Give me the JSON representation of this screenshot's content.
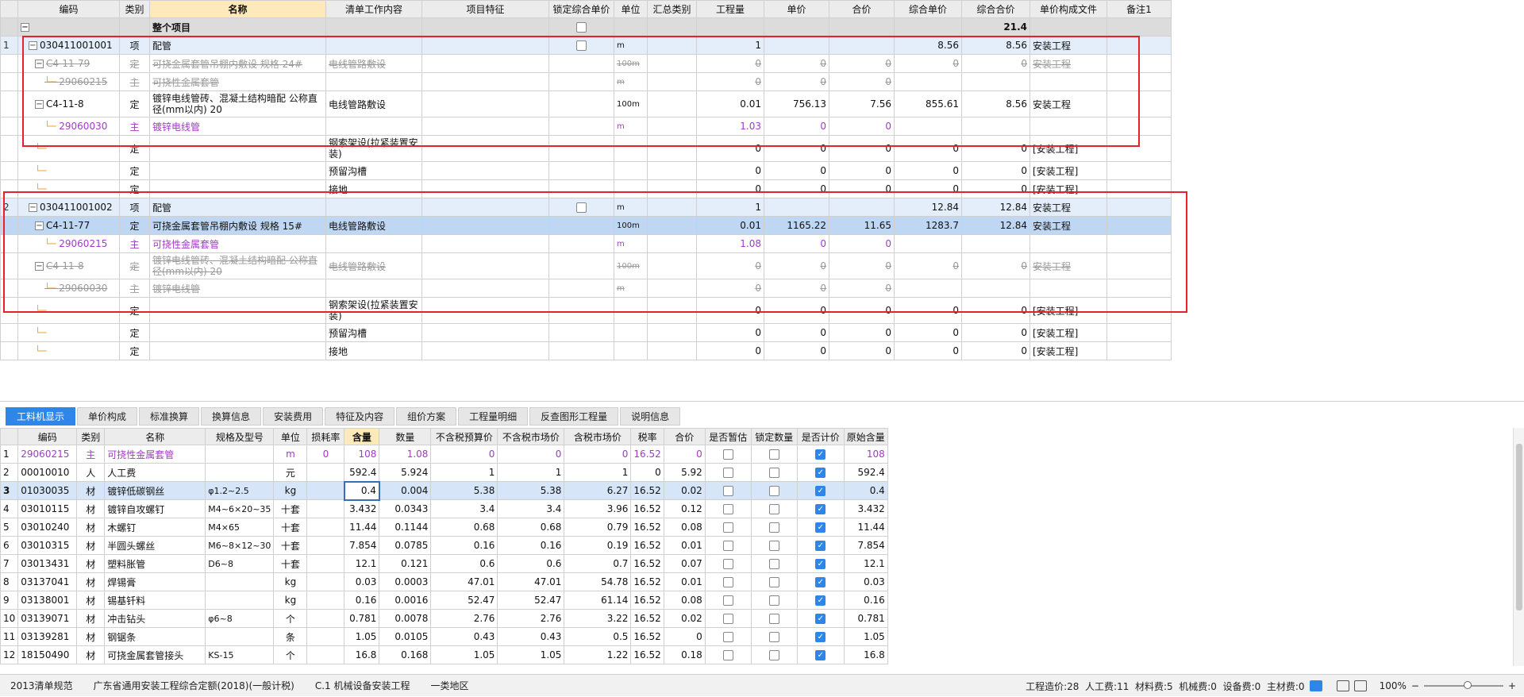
{
  "top_table": {
    "headers": [
      "编码",
      "类别",
      "名称",
      "清单工作内容",
      "项目特征",
      "锁定综合单价",
      "单位",
      "汇总类别",
      "工程量",
      "单价",
      "合价",
      "综合单价",
      "综合合价",
      "单价构成文件",
      "备注1"
    ],
    "rows": [
      {
        "no": "",
        "code": "",
        "type": "",
        "name": "整个项目",
        "work": "",
        "unit": "",
        "qty": "",
        "price": "",
        "total": "",
        "cprice": "",
        "ctotal": "21.4",
        "file": "",
        "kind": "whole"
      },
      {
        "no": "1",
        "code": "030411001001",
        "type": "项",
        "name": "配管",
        "work": "",
        "unit": "m",
        "qty": "1",
        "price": "",
        "total": "",
        "cprice": "8.56",
        "ctotal": "8.56",
        "file": "安装工程",
        "kind": "grp"
      },
      {
        "no": "",
        "code": "C4-11-79",
        "type": "定",
        "name": "可挠金属套管吊棚内敷设 规格 24#",
        "work": "电线管路敷设",
        "unit": "100m",
        "qty": "0",
        "price": "0",
        "total": "0",
        "cprice": "0",
        "ctotal": "0",
        "file": "安装工程",
        "kind": "strike"
      },
      {
        "no": "",
        "code": "29060215",
        "type": "主",
        "name": "可挠性金属套管",
        "work": "",
        "unit": "m",
        "qty": "0",
        "price": "0",
        "total": "0",
        "cprice": "",
        "ctotal": "",
        "file": "",
        "kind": "strike"
      },
      {
        "no": "",
        "code": "C4-11-8",
        "type": "定",
        "name": "镀锌电线管砖、混凝土结构暗配 公称直径(mm以内) 20",
        "work": "电线管路敷设",
        "unit": "100m",
        "qty": "0.01",
        "price": "756.13",
        "total": "7.56",
        "cprice": "855.61",
        "ctotal": "8.56",
        "file": "安装工程",
        "kind": "tall"
      },
      {
        "no": "",
        "code": "29060030",
        "type": "主",
        "name": "镀锌电线管",
        "work": "",
        "unit": "m",
        "qty": "1.03",
        "price": "0",
        "total": "0",
        "cprice": "",
        "ctotal": "",
        "file": "",
        "kind": "purple"
      },
      {
        "no": "",
        "code": "",
        "type": "定",
        "name": "",
        "work": "钢索架设(拉紧装置安装)",
        "unit": "",
        "qty": "0",
        "price": "0",
        "total": "0",
        "cprice": "0",
        "ctotal": "0",
        "file": "[安装工程]",
        "kind": "sub"
      },
      {
        "no": "",
        "code": "",
        "type": "定",
        "name": "",
        "work": "预留沟槽",
        "unit": "",
        "qty": "0",
        "price": "0",
        "total": "0",
        "cprice": "0",
        "ctotal": "0",
        "file": "[安装工程]",
        "kind": "sub"
      },
      {
        "no": "",
        "code": "",
        "type": "定",
        "name": "",
        "work": "接地",
        "unit": "",
        "qty": "0",
        "price": "0",
        "total": "0",
        "cprice": "0",
        "ctotal": "0",
        "file": "[安装工程]",
        "kind": "sub"
      },
      {
        "no": "2",
        "code": "030411001002",
        "type": "项",
        "name": "配管",
        "work": "",
        "unit": "m",
        "qty": "1",
        "price": "",
        "total": "",
        "cprice": "12.84",
        "ctotal": "12.84",
        "file": "安装工程",
        "kind": "grp"
      },
      {
        "no": "",
        "code": "C4-11-77",
        "type": "定",
        "name": "可挠金属套管吊棚内敷设 规格 15#",
        "work": "电线管路敷设",
        "unit": "100m",
        "qty": "0.01",
        "price": "1165.22",
        "total": "11.65",
        "cprice": "1283.7",
        "ctotal": "12.84",
        "file": "安装工程",
        "kind": "sel"
      },
      {
        "no": "",
        "code": "29060215",
        "type": "主",
        "name": "可挠性金属套管",
        "work": "",
        "unit": "m",
        "qty": "1.08",
        "price": "0",
        "total": "0",
        "cprice": "",
        "ctotal": "",
        "file": "",
        "kind": "purple"
      },
      {
        "no": "",
        "code": "C4-11-8",
        "type": "定",
        "name": "镀锌电线管砖、混凝土结构暗配 公称直径(mm以内) 20",
        "work": "电线管路敷设",
        "unit": "100m",
        "qty": "0",
        "price": "0",
        "total": "0",
        "cprice": "0",
        "ctotal": "0",
        "file": "安装工程",
        "kind": "strike-tall"
      },
      {
        "no": "",
        "code": "29060030",
        "type": "主",
        "name": "镀锌电线管",
        "work": "",
        "unit": "m",
        "qty": "0",
        "price": "0",
        "total": "0",
        "cprice": "",
        "ctotal": "",
        "file": "",
        "kind": "strike"
      },
      {
        "no": "",
        "code": "",
        "type": "定",
        "name": "",
        "work": "钢索架设(拉紧装置安装)",
        "unit": "",
        "qty": "0",
        "price": "0",
        "total": "0",
        "cprice": "0",
        "ctotal": "0",
        "file": "[安装工程]",
        "kind": "sub"
      },
      {
        "no": "",
        "code": "",
        "type": "定",
        "name": "",
        "work": "预留沟槽",
        "unit": "",
        "qty": "0",
        "price": "0",
        "total": "0",
        "cprice": "0",
        "ctotal": "0",
        "file": "[安装工程]",
        "kind": "sub"
      },
      {
        "no": "",
        "code": "",
        "type": "定",
        "name": "",
        "work": "接地",
        "unit": "",
        "qty": "0",
        "price": "0",
        "total": "0",
        "cprice": "0",
        "ctotal": "0",
        "file": "[安装工程]",
        "kind": "sub"
      }
    ]
  },
  "tabs": [
    "工料机显示",
    "单价构成",
    "标准换算",
    "换算信息",
    "安装费用",
    "特征及内容",
    "组价方案",
    "工程量明细",
    "反查图形工程量",
    "说明信息"
  ],
  "bottom_table": {
    "headers": [
      "",
      "编码",
      "类别",
      "名称",
      "规格及型号",
      "单位",
      "损耗率",
      "含量",
      "数量",
      "不含税预算价",
      "不含税市场价",
      "含税市场价",
      "税率",
      "合价",
      "是否暂估",
      "锁定数量",
      "是否计价",
      "原始含量"
    ],
    "rows": [
      {
        "no": "1",
        "code": "29060215",
        "type": "主",
        "name": "可挠性金属套管",
        "spec": "",
        "unit": "m",
        "loss": "0",
        "content": "108",
        "amount": "1.08",
        "p1": "0",
        "p2": "0",
        "p3": "0",
        "tax": "16.52",
        "total": "0",
        "est": false,
        "lock": false,
        "calc": true,
        "orig": "108",
        "purple": true
      },
      {
        "no": "2",
        "code": "00010010",
        "type": "人",
        "name": "人工费",
        "spec": "",
        "unit": "元",
        "loss": "",
        "content": "592.4",
        "amount": "5.924",
        "p1": "1",
        "p2": "1",
        "p3": "1",
        "tax": "0",
        "total": "5.92",
        "est": false,
        "lock": false,
        "calc": true,
        "orig": "592.4"
      },
      {
        "no": "3",
        "code": "01030035",
        "type": "材",
        "name": "镀锌低碳钢丝",
        "spec": "φ1.2~2.5",
        "unit": "kg",
        "loss": "",
        "content": "0.4",
        "amount": "0.004",
        "p1": "5.38",
        "p2": "5.38",
        "p3": "6.27",
        "tax": "16.52",
        "total": "0.02",
        "est": false,
        "lock": false,
        "calc": true,
        "orig": "0.4",
        "sel": true
      },
      {
        "no": "4",
        "code": "03010115",
        "type": "材",
        "name": "镀锌自攻螺钉",
        "spec": "M4~6×20~35",
        "unit": "十套",
        "loss": "",
        "content": "3.432",
        "amount": "0.0343",
        "p1": "3.4",
        "p2": "3.4",
        "p3": "3.96",
        "tax": "16.52",
        "total": "0.12",
        "est": false,
        "lock": false,
        "calc": true,
        "orig": "3.432"
      },
      {
        "no": "5",
        "code": "03010240",
        "type": "材",
        "name": "木螺钉",
        "spec": "M4×65",
        "unit": "十套",
        "loss": "",
        "content": "11.44",
        "amount": "0.1144",
        "p1": "0.68",
        "p2": "0.68",
        "p3": "0.79",
        "tax": "16.52",
        "total": "0.08",
        "est": false,
        "lock": false,
        "calc": true,
        "orig": "11.44"
      },
      {
        "no": "6",
        "code": "03010315",
        "type": "材",
        "name": "半圆头螺丝",
        "spec": "M6~8×12~30",
        "unit": "十套",
        "loss": "",
        "content": "7.854",
        "amount": "0.0785",
        "p1": "0.16",
        "p2": "0.16",
        "p3": "0.19",
        "tax": "16.52",
        "total": "0.01",
        "est": false,
        "lock": false,
        "calc": true,
        "orig": "7.854"
      },
      {
        "no": "7",
        "code": "03013431",
        "type": "材",
        "name": "塑料胀管",
        "spec": "D6~8",
        "unit": "十套",
        "loss": "",
        "content": "12.1",
        "amount": "0.121",
        "p1": "0.6",
        "p2": "0.6",
        "p3": "0.7",
        "tax": "16.52",
        "total": "0.07",
        "est": false,
        "lock": false,
        "calc": true,
        "orig": "12.1"
      },
      {
        "no": "8",
        "code": "03137041",
        "type": "材",
        "name": "焊锡膏",
        "spec": "",
        "unit": "kg",
        "loss": "",
        "content": "0.03",
        "amount": "0.0003",
        "p1": "47.01",
        "p2": "47.01",
        "p3": "54.78",
        "tax": "16.52",
        "total": "0.01",
        "est": false,
        "lock": false,
        "calc": true,
        "orig": "0.03"
      },
      {
        "no": "9",
        "code": "03138001",
        "type": "材",
        "name": "锡基钎料",
        "spec": "",
        "unit": "kg",
        "loss": "",
        "content": "0.16",
        "amount": "0.0016",
        "p1": "52.47",
        "p2": "52.47",
        "p3": "61.14",
        "tax": "16.52",
        "total": "0.08",
        "est": false,
        "lock": false,
        "calc": true,
        "orig": "0.16"
      },
      {
        "no": "10",
        "code": "03139071",
        "type": "材",
        "name": "冲击钻头",
        "spec": "φ6~8",
        "unit": "个",
        "loss": "",
        "content": "0.781",
        "amount": "0.0078",
        "p1": "2.76",
        "p2": "2.76",
        "p3": "3.22",
        "tax": "16.52",
        "total": "0.02",
        "est": false,
        "lock": false,
        "calc": true,
        "orig": "0.781"
      },
      {
        "no": "11",
        "code": "03139281",
        "type": "材",
        "name": "钢锯条",
        "spec": "",
        "unit": "条",
        "loss": "",
        "content": "1.05",
        "amount": "0.0105",
        "p1": "0.43",
        "p2": "0.43",
        "p3": "0.5",
        "tax": "16.52",
        "total": "0",
        "est": false,
        "lock": false,
        "calc": true,
        "orig": "1.05"
      },
      {
        "no": "12",
        "code": "18150490",
        "type": "材",
        "name": "可挠金属套管接头",
        "spec": "KS-15",
        "unit": "个",
        "loss": "",
        "content": "16.8",
        "amount": "0.168",
        "p1": "1.05",
        "p2": "1.05",
        "p3": "1.22",
        "tax": "16.52",
        "total": "0.18",
        "est": false,
        "lock": false,
        "calc": true,
        "orig": "16.8"
      }
    ]
  },
  "status": {
    "items": [
      "2013清单规范",
      "广东省通用安装工程综合定额(2018)(一般计税)",
      "C.1 机械设备安装工程",
      "一类地区"
    ],
    "right": "工程造价:28  人工费:11  材料费:5  机械费:0  设备费:0  主材费:0",
    "zoom": "100%"
  },
  "colors": {
    "accent": "#2e86e8",
    "redbox": "#e8202a",
    "purple": "#a239ca"
  }
}
